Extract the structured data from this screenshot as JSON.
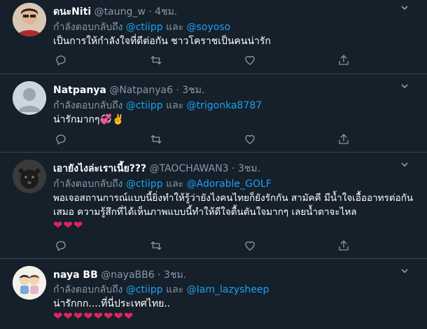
{
  "colors": {
    "background": "#15202b",
    "divider": "#38444d",
    "muted": "#8899a6",
    "link": "#1da1f2",
    "heart": "#e0245e"
  },
  "icons": {
    "more": "chevron-down-icon",
    "reply": "reply-icon",
    "retweet": "retweet-icon",
    "like": "like-icon",
    "share": "share-icon"
  },
  "tweets": [
    {
      "name": "ดนะNiti",
      "handle": "@taung_w",
      "sep": "·",
      "time": "4ชม.",
      "reply_prefix": "กำลังตอบกลับถึง",
      "mention1": "@ctiipp",
      "and": "และ",
      "mention2": "@soyoso",
      "text": "เป็นการให้กำลังใจที่ดีต่อกัน ชาวโคราชเป็นคนน่ารัก"
    },
    {
      "name": "Natpanya",
      "handle": "@Natpanya6",
      "sep": "·",
      "time": "3ชม.",
      "reply_prefix": "กำลังตอบกลับถึง",
      "mention1": "@ctiipp",
      "and": "และ",
      "mention2": "@trigonka8787",
      "text": "น่ารักมากๆ💞✌️"
    },
    {
      "name": "เอายังไงล่ะเราเนี้ย???",
      "handle": "@TAOCHAWAN3",
      "sep": "·",
      "time": "3ชม.",
      "reply_prefix": "กำลังตอบกลับถึง",
      "mention1": "@ctiipp",
      "and": "และ",
      "mention2": "@Adorable_GOLF",
      "text": "พอเจอสถานการณ์แบบนี้ยิ่งทำให้รู้ว่ายังไงคนไทยก็ยังรักกัน สามัคคี มีน้ำใจเอื้ออาทรต่อกันเสมอ ความรู้สึกที่ได้เห็นภาพแบบนี้ทำให้ดีใจตื้นตันใจมากๆ เลยน้ำตาจะไหล",
      "emoji": "❤❤❤"
    },
    {
      "name": "naya BB",
      "handle": "@nayaBB6",
      "sep": "·",
      "time": "3ชม.",
      "reply_prefix": "กำลังตอบกลับถึง",
      "mention1": "@ctiipp",
      "and": "และ",
      "mention2": "@Iam_lazysheep",
      "text": "น่ารักกก....ที่นี่ประเทศไทย..",
      "emoji": "❤❤❤❤❤❤❤❤"
    }
  ]
}
